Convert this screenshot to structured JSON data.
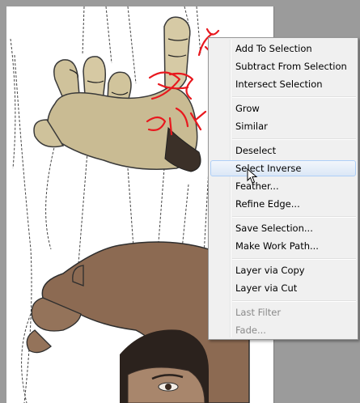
{
  "context_menu": {
    "items": [
      {
        "label": "Add To Selection"
      },
      {
        "label": "Subtract From Selection"
      },
      {
        "label": "Intersect Selection"
      },
      {
        "label": "Grow"
      },
      {
        "label": "Similar"
      },
      {
        "label": "Deselect"
      },
      {
        "label": "Select Inverse"
      },
      {
        "label": "Feather..."
      },
      {
        "label": "Refine Edge..."
      },
      {
        "label": "Save Selection..."
      },
      {
        "label": "Make Work Path..."
      },
      {
        "label": "Layer via Copy"
      },
      {
        "label": "Layer via Cut"
      },
      {
        "label": "Last Filter"
      },
      {
        "label": "Fade..."
      }
    ]
  },
  "annotation": {
    "text": "right click",
    "color": "#e8181e"
  },
  "colors": {
    "canvas_background": "#9b9b9b",
    "document": "#ffffff",
    "menu_background": "#f0f0f0",
    "menu_hover": "#dbe7f6",
    "annotation": "#e8181e"
  }
}
